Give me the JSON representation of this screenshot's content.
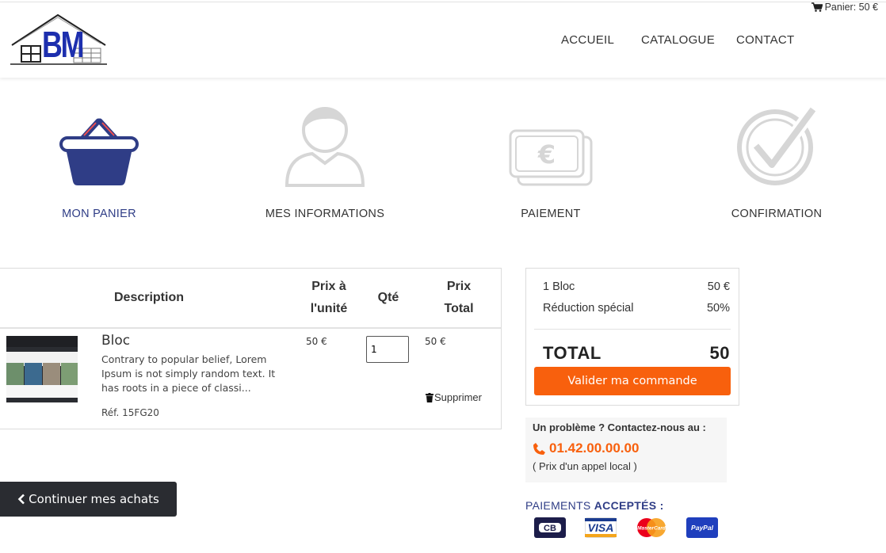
{
  "header": {
    "logo_text": "BM",
    "cart_label": "Panier: 50 €",
    "nav": [
      "ACCUEIL",
      "CATALOGUE",
      "CONTACT"
    ]
  },
  "steps": [
    {
      "label": "MON PANIER",
      "icon": "basket-icon",
      "active": true
    },
    {
      "label": "MES INFORMATIONS",
      "icon": "user-icon",
      "active": false
    },
    {
      "label": "PAIEMENT",
      "icon": "euro-banknote-icon",
      "active": false
    },
    {
      "label": "CONFIRMATION",
      "icon": "checkmark-circle-icon",
      "active": false
    }
  ],
  "cart_table": {
    "headers": {
      "description": "Description",
      "unit_price_line1": "Prix à",
      "unit_price_line2": "l'unité",
      "quantity": "Qté",
      "total_line1": "Prix",
      "total_line2": "Total"
    },
    "rows": [
      {
        "title": "Bloc",
        "description": "Contrary to popular belief, Lorem Ipsum is not simply random text. It has roots in a piece of classi...",
        "reference": "Réf. 15FG20",
        "unit_price": "50 €",
        "quantity": "1",
        "total_price": "50 €",
        "delete_label": "Supprimer"
      }
    ]
  },
  "summary": {
    "item_label": "1 Bloc",
    "item_price": "50 €",
    "discount_label": "Réduction spécial",
    "discount_value": "50%",
    "total_label": "TOTAL",
    "total_value": "50",
    "validate_label": "Valider ma commande"
  },
  "contact": {
    "title": "Un problème ? Contactez-nous au :",
    "phone": "01.42.00.00.00",
    "note": "( Prix d'un appel local )"
  },
  "payments": {
    "title_prefix": "PAIEMENTS ",
    "title_emphasis": "ACCEPTÉS :",
    "cards": [
      {
        "name": "cb-card-icon",
        "label": "CB"
      },
      {
        "name": "visa-card-icon",
        "label": "VISA"
      },
      {
        "name": "mastercard-icon",
        "label": "MasterCard"
      },
      {
        "name": "paypal-icon",
        "label": "PayPal"
      }
    ]
  },
  "continue_label": "Continuer mes achats",
  "colors": {
    "accent": "#f8600d",
    "brand_blue": "#2f3d86",
    "dark": "#2a2c31",
    "inactive_icon": "#d6d6d6"
  }
}
